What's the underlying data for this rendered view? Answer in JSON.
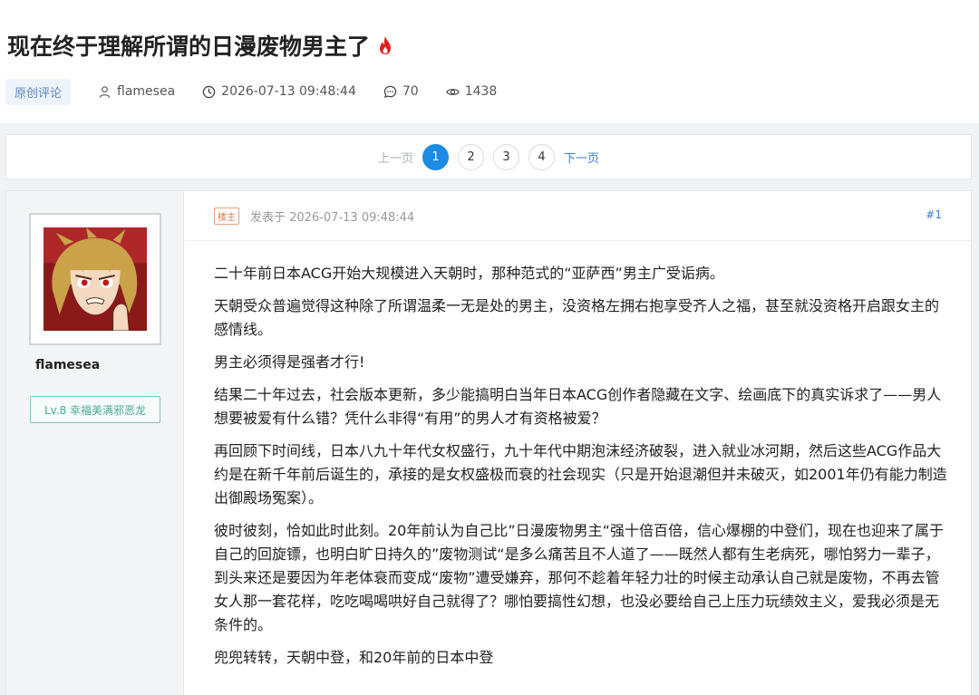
{
  "post": {
    "title": "现在终于理解所谓的日漫废物男主了",
    "tag": "原创评论",
    "author": "flamesea",
    "datetime": "2026-07-13 09:48:44",
    "comments": "70",
    "views": "1438"
  },
  "pagination": {
    "prev": "上一页",
    "pages": [
      "1",
      "2",
      "3",
      "4"
    ],
    "next": "下一页"
  },
  "floor": {
    "op_badge": "楼主",
    "posted_at": "发表于 2026-07-13 09:48:44",
    "number": "#1",
    "username": "flamesea",
    "level": "Lv.8 幸福美满邪恶龙",
    "paragraphs": [
      "二十年前日本ACG开始大规模进入天朝时，那种范式的“亚萨西”男主广受诟病。",
      "天朝受众普遍觉得这种除了所谓温柔一无是处的男主，没资格左拥右抱享受齐人之福，甚至就没资格开启跟女主的感情线。",
      "男主必须得是强者才行!",
      "结果二十年过去，社会版本更新，多少能搞明白当年日本ACG创作者隐藏在文字、绘画底下的真实诉求了——男人想要被爱有什么错？凭什么非得“有用”的男人才有资格被爱？",
      "再回顾下时间线，日本八九十年代女权盛行，九十年代中期泡沫经济破裂，进入就业冰河期，然后这些ACG作品大约是在新千年前后诞生的，承接的是女权盛极而衰的社会现实（只是开始退潮但并未破灭，如2001年仍有能力制造出御殿场冤案）。",
      "彼时彼刻，恰如此时此刻。20年前认为自己比”日漫废物男主“强十倍百倍，信心爆棚的中登们，现在也迎来了属于自己的回旋镖，也明白旷日持久的”废物测试“是多么痛苦且不人道了——既然人都有生老病死，哪怕努力一辈子，到头来还是要因为年老体衰而变成“废物”遭受嫌弃，那何不趁着年轻力壮的时候主动承认自己就是废物，不再去管女人那一套花样，吃吃喝喝哄好自己就得了？哪怕要搞性幻想，也没必要给自己上压力玩绩效主义，爱我必须是无条件的。",
      "兜兜转转，天朝中登，和20年前的日本中登"
    ]
  },
  "colors": {
    "accent": "#1f8ae4",
    "flame": "#e0201e",
    "level": "#4aa996"
  }
}
